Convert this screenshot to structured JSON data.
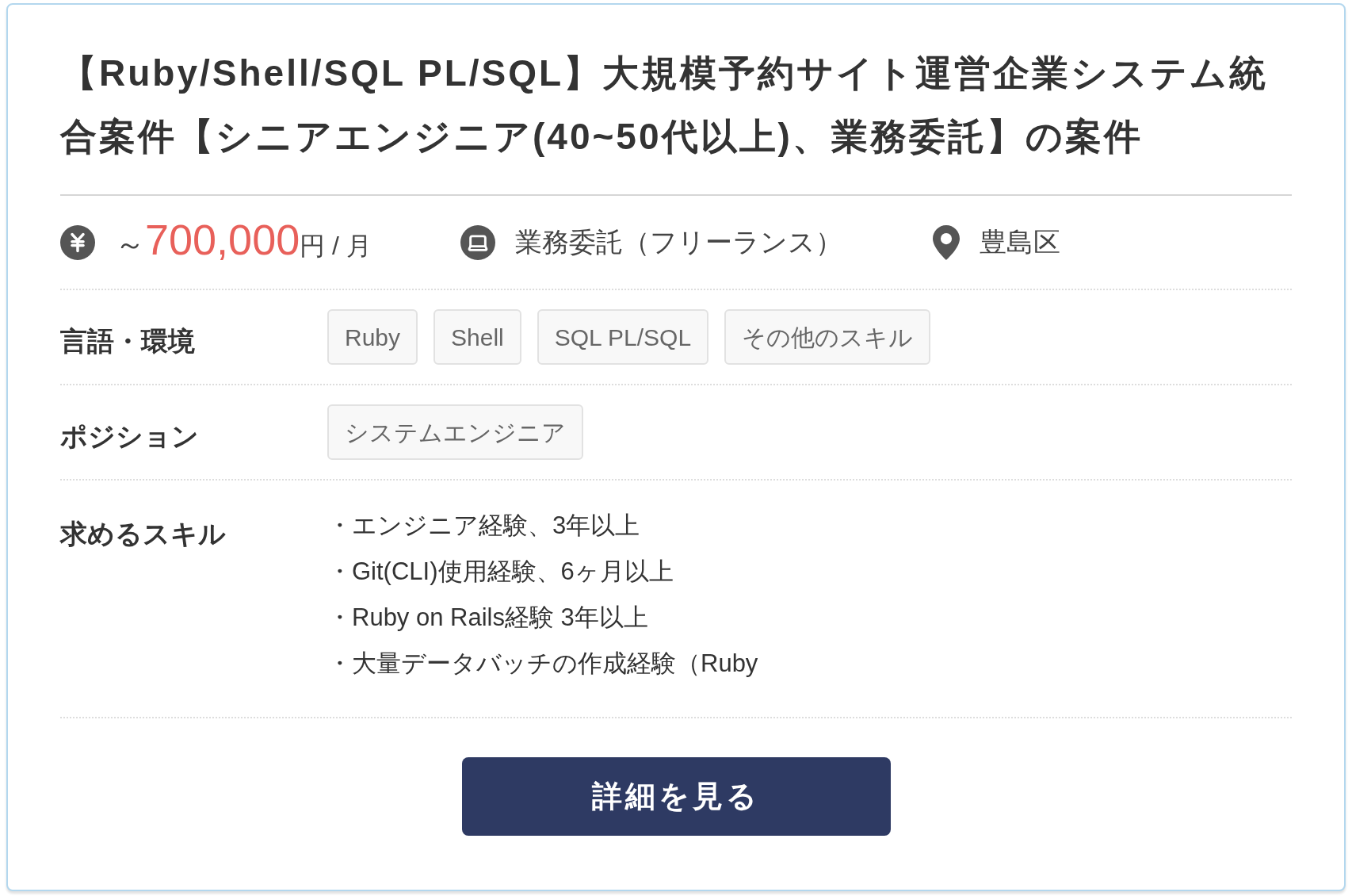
{
  "title": "【Ruby/Shell/SQL PL/SQL】大規模予約サイト運営企業システム統合案件【シニアエンジニア(40~50代以上)、業務委託】の案件",
  "summary": {
    "salary_prefix": "～",
    "salary_amount": "700,000",
    "salary_unit": "円 / 月",
    "contract_type": "業務委託（フリーランス）",
    "location": "豊島区"
  },
  "details": [
    {
      "kind": "tags",
      "label": "言語・環境",
      "tags": [
        "Ruby",
        "Shell",
        "SQL PL/SQL",
        "その他のスキル"
      ]
    },
    {
      "kind": "tags",
      "label": "ポジション",
      "tags": [
        "システムエンジニア"
      ]
    },
    {
      "kind": "list",
      "label": "求めるスキル",
      "items": [
        "・エンジニア経験、3年以上",
        "・Git(CLI)使用経験、6ヶ月以上",
        "・Ruby on Rails経験 3年以上",
        "・大量データバッチの作成経験（Ruby"
      ]
    }
  ],
  "button_label": "詳細を見る"
}
